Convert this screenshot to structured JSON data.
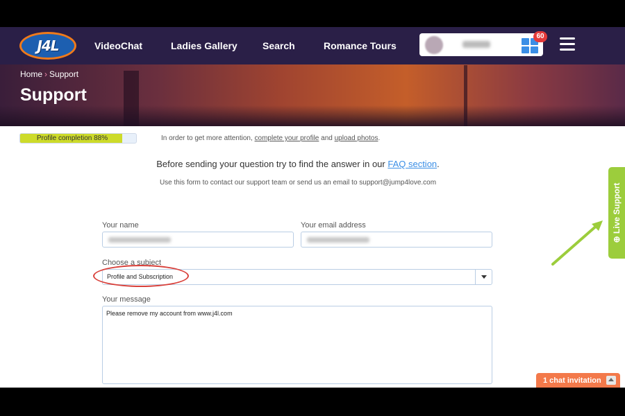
{
  "nav": {
    "logo_text": "J4L",
    "links": [
      "VideoChat",
      "Ladies Gallery",
      "Search",
      "Romance Tours"
    ],
    "notifications_count": "60"
  },
  "hero": {
    "breadcrumb": [
      "Home",
      "Support"
    ],
    "title": "Support"
  },
  "profile": {
    "completion_label": "Profile completion 88%",
    "completion_value": 0.88,
    "note_prefix": "In order to get more attention, ",
    "note_link1": "complete your profile",
    "note_mid": " and ",
    "note_link2": "upload photos",
    "note_suffix": "."
  },
  "intro": {
    "text_before": "Before sending your question try to find the answer in our ",
    "faq_link": "FAQ section",
    "text_after": ".",
    "contact": "Use this form to contact our support team or send us an email to support@jump4love.com"
  },
  "form": {
    "name_label": "Your name",
    "email_label": "Your email address",
    "subject_label": "Choose a subject",
    "subject_value": "Profile and Subscription",
    "message_label": "Your message",
    "message_value": "Please remove my account from www.j4l.com"
  },
  "live_support": {
    "label": "Live Support"
  },
  "chat": {
    "label": "1 chat invitation"
  },
  "colors": {
    "nav_bg": "#2a1f47",
    "link": "#3a8ee6",
    "live_support": "#9ccd3c",
    "chat": "#f3794a",
    "annotation": "#d9403a"
  }
}
